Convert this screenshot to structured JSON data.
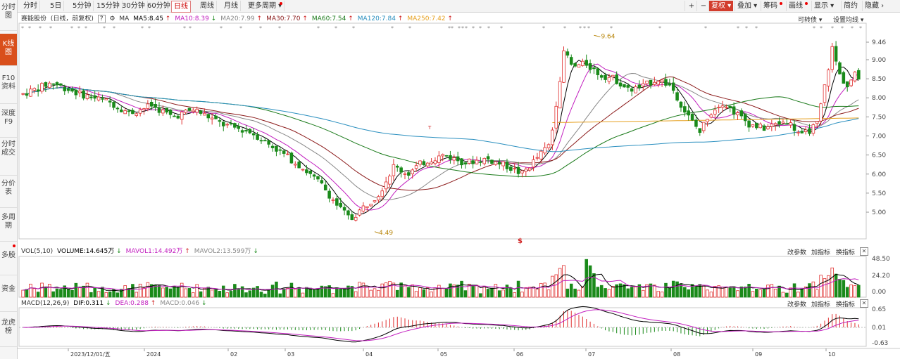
{
  "toolbar": {
    "periods": [
      "分时",
      "5日",
      "5分钟",
      "15分钟",
      "30分钟",
      "60分钟",
      "日线",
      "周线",
      "月线",
      "更多周期"
    ],
    "active_period": "日线",
    "tools": [
      "复权",
      "叠加",
      "筹码",
      "画线",
      "显示",
      "简约",
      "隐藏"
    ],
    "zoom_in": "+",
    "zoom_out": "−"
  },
  "sidebar": {
    "tabs": [
      "分时图",
      "K线图",
      "F10资料",
      "深度F9",
      "分时成交",
      "分价表",
      "多周期",
      "多股",
      "资金",
      "龙虎榜"
    ],
    "active_tab": "K线图"
  },
  "stock": {
    "name": "赛能股份",
    "mode": "(日线，前复权)",
    "help": "?",
    "convert_bond": "可转债",
    "set_ma": "设置均线"
  },
  "ma_line": {
    "label": "MA",
    "items": [
      {
        "label": "MA5:8.45",
        "arrow": "↑",
        "color": "#000000"
      },
      {
        "label": "MA10:8.39",
        "arrow": "↓",
        "color": "#c21fbf"
      },
      {
        "label": "MA20:7.99",
        "arrow": "↑",
        "color": "#888888"
      },
      {
        "label": "MA30:7.70",
        "arrow": "↑",
        "color": "#8b1a1a"
      },
      {
        "label": "MA60:7.54",
        "arrow": "↑",
        "color": "#1a7a1a"
      },
      {
        "label": "MA120:7.84",
        "arrow": "↑",
        "color": "#2a8fbf"
      },
      {
        "label": "MA250:7.42",
        "arrow": "↑",
        "color": "#e6a020"
      }
    ]
  },
  "price_axis": [
    "9.46",
    "9.00",
    "8.50",
    "8.00",
    "7.50",
    "7.00",
    "6.50",
    "6.00",
    "5.50",
    "5.00"
  ],
  "annotations": {
    "high": "9.64",
    "low": "4.49",
    "special_marker": "$",
    "event_t": "T"
  },
  "volume_panel": {
    "label": "VOL(5,10)",
    "items": [
      {
        "label": "VOLUME:14.645万",
        "arrow": "↓",
        "color": "#000000"
      },
      {
        "label": "MAVOL1:14.492万",
        "arrow": "↑",
        "color": "#c21fbf"
      },
      {
        "label": "MAVOL2:13.599万",
        "arrow": "↓",
        "color": "#888888"
      }
    ],
    "axis": [
      "48.50",
      "24.20",
      "0.00"
    ],
    "buttons": [
      "改参数",
      "加指标",
      "换指标"
    ]
  },
  "macd_panel": {
    "label": "MACD(12,26,9)",
    "items": [
      {
        "label": "DIF:0.311",
        "arrow": "↓",
        "color": "#000000"
      },
      {
        "label": "DEA:0.288",
        "arrow": "↑",
        "color": "#c21fbf"
      },
      {
        "label": "MACD:0.046",
        "arrow": "↓",
        "color": "#888888"
      }
    ],
    "axis": [
      "0.65",
      "0.01",
      "-0.63"
    ],
    "buttons": [
      "改参数",
      "加指标",
      "换指标"
    ]
  },
  "time_axis": [
    "2023/12/01/五",
    "2024",
    "02",
    "03",
    "04",
    "05",
    "06",
    "07",
    "08",
    "09",
    "10"
  ],
  "colors": {
    "up": "#e03030",
    "down": "#1a8a1a",
    "accent": "#d23c2c"
  }
}
